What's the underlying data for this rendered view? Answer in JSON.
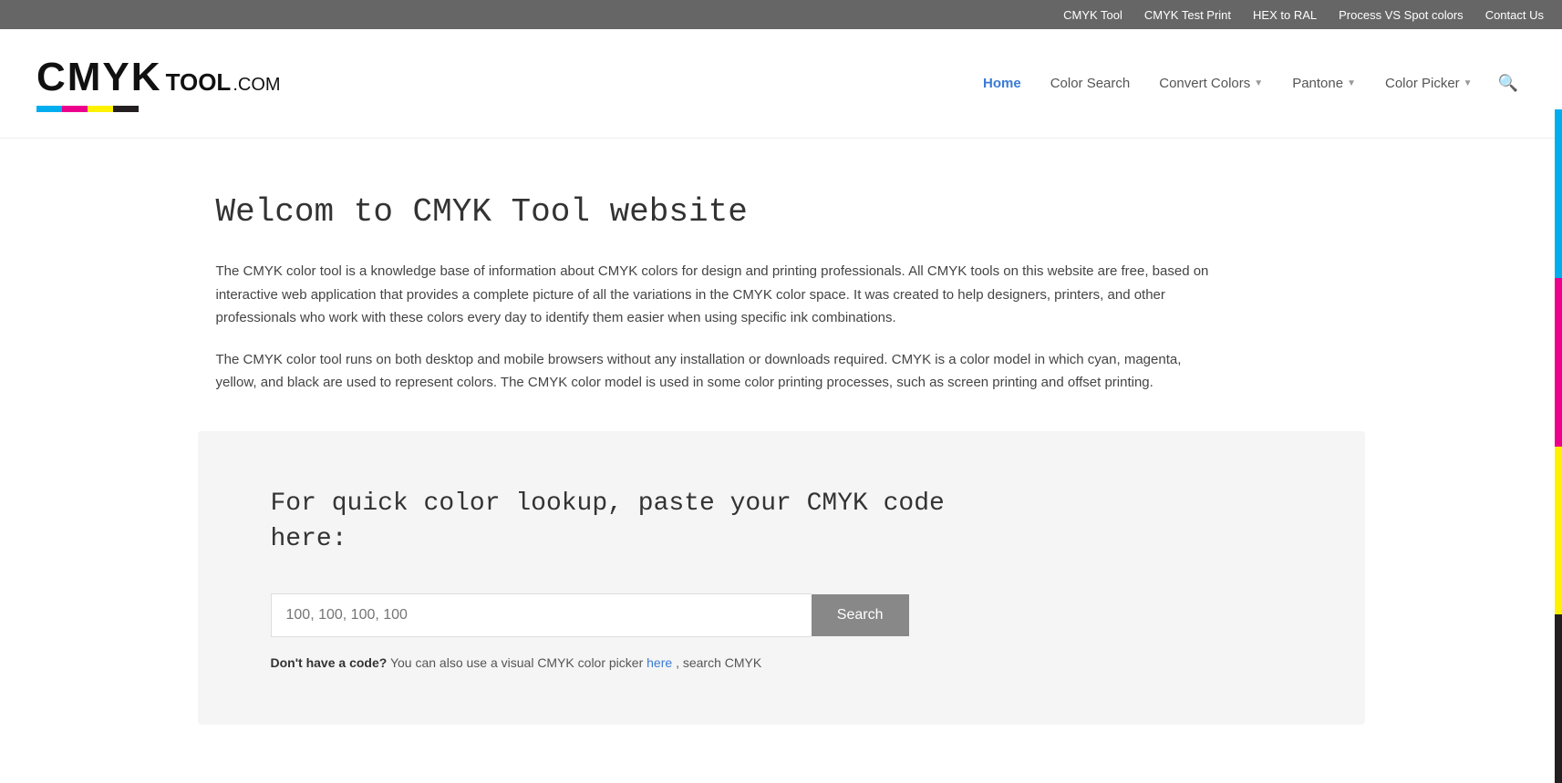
{
  "topbar": {
    "links": [
      {
        "id": "cmyk-tool",
        "label": "CMYK Tool",
        "url": "#"
      },
      {
        "id": "cmyk-test-print",
        "label": "CMYK Test Print",
        "url": "#"
      },
      {
        "id": "hex-to-ral",
        "label": "HEX to RAL",
        "url": "#"
      },
      {
        "id": "process-vs-spot",
        "label": "Process VS Spot colors",
        "url": "#"
      },
      {
        "id": "contact-us",
        "label": "Contact Us",
        "url": "#"
      }
    ]
  },
  "header": {
    "logo": {
      "cmyk": "CMYK",
      "tool": "TOOL",
      "dotcom": ".COM"
    },
    "nav": [
      {
        "id": "home",
        "label": "Home",
        "active": true,
        "hasDropdown": false
      },
      {
        "id": "color-search",
        "label": "Color Search",
        "active": false,
        "hasDropdown": false
      },
      {
        "id": "convert-colors",
        "label": "Convert Colors",
        "active": false,
        "hasDropdown": true
      },
      {
        "id": "pantone",
        "label": "Pantone",
        "active": false,
        "hasDropdown": true
      },
      {
        "id": "color-picker",
        "label": "Color Picker",
        "active": false,
        "hasDropdown": true
      }
    ]
  },
  "main": {
    "title": "Welcom to CMYK Tool website",
    "para1": "The CMYK color tool is a knowledge base of information about CMYK colors for design and printing professionals. All CMYK tools on this website are free, based on interactive web application that provides a complete picture of all the variations in the CMYK color space. It was created to help designers, printers, and other professionals who work with these colors every day to identify them easier when using specific ink combinations.",
    "para2": "The CMYK color tool runs on both desktop and mobile browsers without any installation or downloads required. CMYK is a color model in which cyan, magenta, yellow, and black are used to represent colors. The CMYK color model is used in some color printing processes, such as screen printing and offset printing.",
    "lookup": {
      "title_line1": "For quick color lookup, paste your CMYK code",
      "title_line2": "here:",
      "input_placeholder": "100, 100, 100, 100",
      "button_label": "Search",
      "dont_have_prefix": "Don't have a code?",
      "dont_have_text": " You can also use a visual CMYK color picker ",
      "dont_have_link": "here",
      "dont_have_suffix": ", search CMYK"
    }
  },
  "colors": {
    "cyan": "#00aeef",
    "magenta": "#ec008c",
    "yellow": "#fff200",
    "black": "#231f20"
  }
}
